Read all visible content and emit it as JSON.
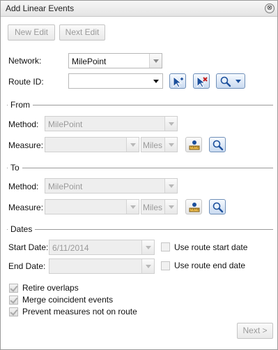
{
  "window": {
    "title": "Add Linear Events",
    "close_glyph": "⊗"
  },
  "toolbar": {
    "new_edit": "New Edit",
    "next_edit": "Next Edit"
  },
  "network": {
    "label": "Network:",
    "value": "MilePoint"
  },
  "route": {
    "label": "Route ID:",
    "value": ""
  },
  "from": {
    "section": "From",
    "method_label": "Method:",
    "method_value": "MilePoint",
    "measure_label": "Measure:",
    "measure_value": "",
    "units": "Miles"
  },
  "to": {
    "section": "To",
    "method_label": "Method:",
    "method_value": "MilePoint",
    "measure_label": "Measure:",
    "measure_value": "",
    "units": "Miles"
  },
  "dates": {
    "section": "Dates",
    "start_label": "Start Date:",
    "start_value": "6/11/2014",
    "start_checkbox": "Use route start date",
    "end_label": "End Date:",
    "end_value": "",
    "end_checkbox": "Use route end date"
  },
  "options": {
    "retire_overlaps": "Retire overlaps",
    "merge_coincident": "Merge coincident events",
    "prevent_measures": "Prevent measures not on route"
  },
  "footer": {
    "next": "Next >"
  },
  "colors": {
    "accent_border": "#6f8fb8",
    "accent_fill": "#c9daf0",
    "icon_blue": "#1b4f9c",
    "icon_red": "#c41d1d"
  },
  "icons": [
    "select-route-from-map-icon",
    "clear-route-icon",
    "search-icon",
    "measure-ruler-icon",
    "zoom-search-icon"
  ]
}
